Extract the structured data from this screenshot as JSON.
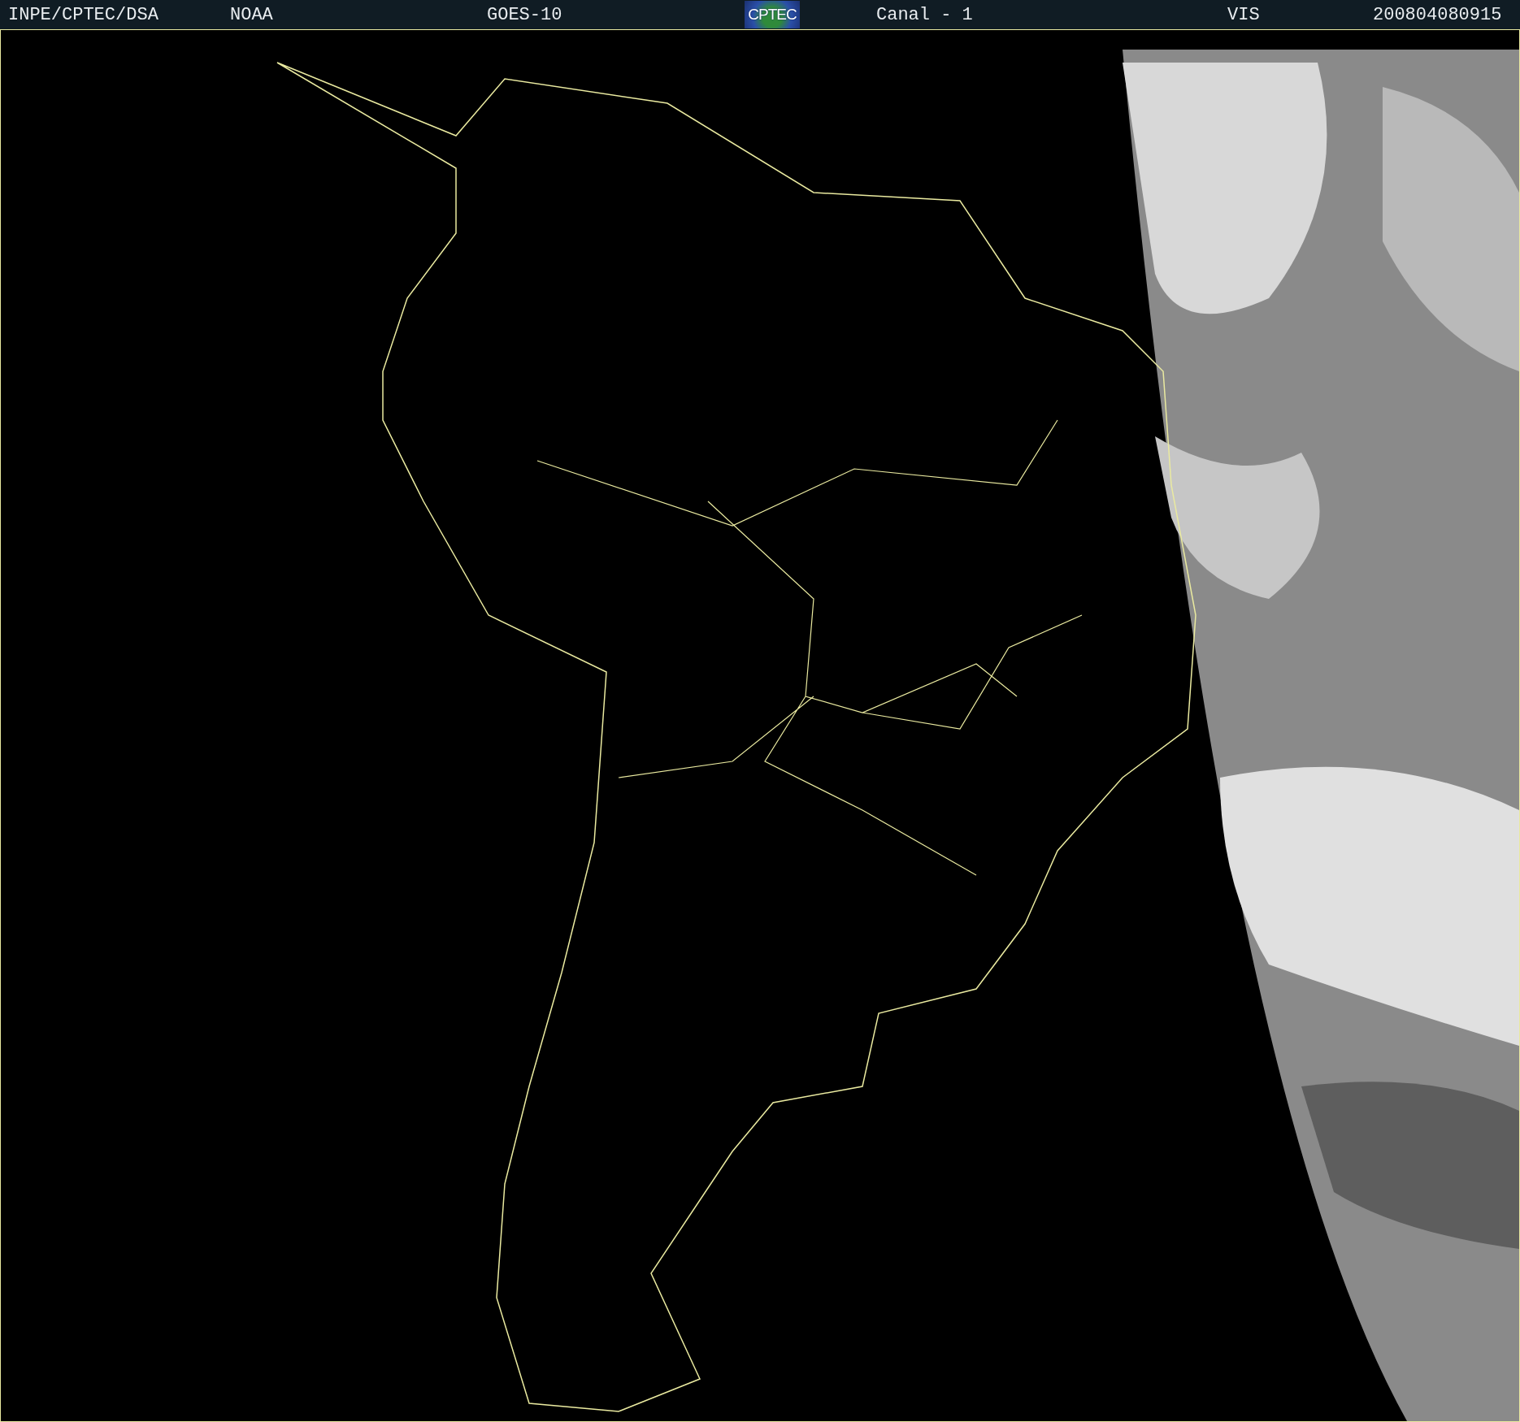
{
  "header": {
    "items": [
      {
        "kind": "text",
        "text": "INPE/CPTEC/DSA"
      },
      {
        "kind": "text",
        "text": "NOAA"
      },
      {
        "kind": "text",
        "text": "GOES-10"
      },
      {
        "kind": "logo",
        "text": "CPTEC"
      },
      {
        "kind": "text",
        "text": "Canal - 1"
      },
      {
        "kind": "text",
        "text": "VIS"
      },
      {
        "kind": "text",
        "text": "200804080915"
      }
    ]
  }
}
